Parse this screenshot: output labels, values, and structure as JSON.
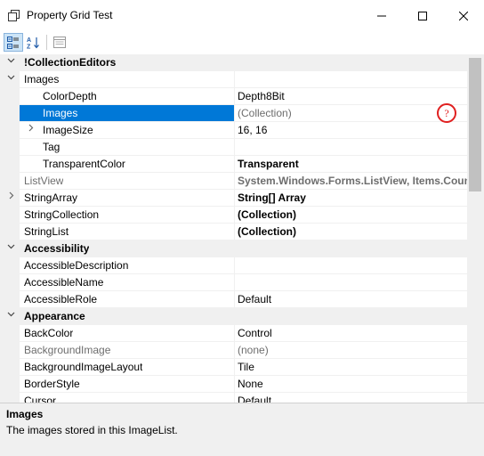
{
  "window": {
    "title": "Property Grid Test"
  },
  "icons": {
    "app": "property-grid-app-icon",
    "minimize": "minimize-icon",
    "maximize": "maximize-icon",
    "close": "close-icon",
    "categorized": "categorized-view-icon",
    "alphabetical": "alphabetical-sort-icon",
    "property_pages": "property-pages-icon",
    "help_marker": "question-mark-icon"
  },
  "grid": {
    "rows": [
      {
        "type": "category",
        "label": "!CollectionEditors",
        "expanded": true
      },
      {
        "type": "property",
        "indent": 0,
        "label": "Images",
        "value": "",
        "toggle": "expanded"
      },
      {
        "type": "property",
        "indent": 1,
        "label": "ColorDepth",
        "value": "Depth8Bit"
      },
      {
        "type": "property",
        "indent": 1,
        "label": "Images",
        "value": "(Collection)",
        "selected": true,
        "value_style": "readonly"
      },
      {
        "type": "property",
        "indent": 1,
        "label": "ImageSize",
        "value": "16, 16",
        "toggle": "collapsed"
      },
      {
        "type": "property",
        "indent": 1,
        "label": "Tag",
        "value": ""
      },
      {
        "type": "property",
        "indent": 1,
        "label": "TransparentColor",
        "value": "Transparent",
        "value_style": "bold"
      },
      {
        "type": "property",
        "indent": 0,
        "label": "ListView",
        "value": "System.Windows.Forms.ListView, Items.Count:",
        "label_style": "readonly",
        "value_style": "bold-gray"
      },
      {
        "type": "property",
        "indent": 0,
        "label": "StringArray",
        "value": "String[] Array",
        "toggle": "collapsed",
        "value_style": "bold"
      },
      {
        "type": "property",
        "indent": 0,
        "label": "StringCollection",
        "value": "(Collection)",
        "value_style": "bold"
      },
      {
        "type": "property",
        "indent": 0,
        "label": "StringList",
        "value": "(Collection)",
        "value_style": "bold"
      },
      {
        "type": "category",
        "label": "Accessibility",
        "expanded": true
      },
      {
        "type": "property",
        "indent": 0,
        "label": "AccessibleDescription",
        "value": ""
      },
      {
        "type": "property",
        "indent": 0,
        "label": "AccessibleName",
        "value": ""
      },
      {
        "type": "property",
        "indent": 0,
        "label": "AccessibleRole",
        "value": "Default"
      },
      {
        "type": "category",
        "label": "Appearance",
        "expanded": true
      },
      {
        "type": "property",
        "indent": 0,
        "label": "BackColor",
        "value": "Control"
      },
      {
        "type": "property",
        "indent": 0,
        "label": "BackgroundImage",
        "value": "(none)",
        "label_style": "readonly",
        "value_style": "readonly"
      },
      {
        "type": "property",
        "indent": 0,
        "label": "BackgroundImageLayout",
        "value": "Tile"
      },
      {
        "type": "property",
        "indent": 0,
        "label": "BorderStyle",
        "value": "None"
      },
      {
        "type": "property",
        "indent": 0,
        "label": "Cursor",
        "value": "Default"
      }
    ]
  },
  "help": {
    "title": "Images",
    "description": "The images stored in this ImageList."
  },
  "help_marker": {
    "glyph": "?"
  },
  "colors": {
    "selection": "#0078d7",
    "readonly_text": "#6d6d6d",
    "category_bg": "#f0f0f0",
    "marker": "#e02020"
  }
}
